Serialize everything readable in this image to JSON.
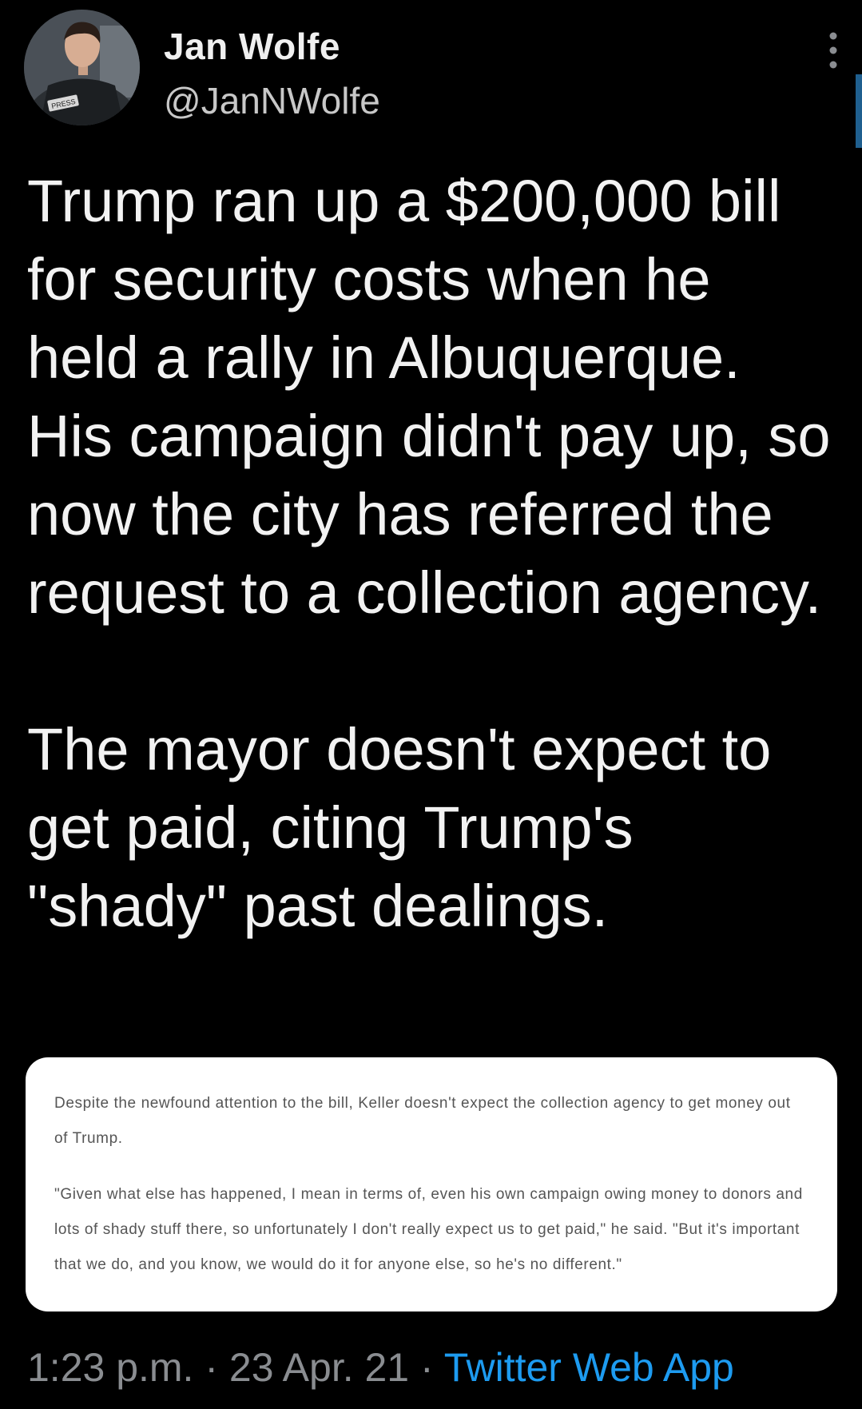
{
  "author": {
    "display_name": "Jan Wolfe",
    "handle": "@JanNWolfe",
    "avatar_badge_text": "PRESS"
  },
  "tweet": {
    "paragraphs": [
      "Trump ran up a $200,000 bill for security costs when he held a rally in Albuquerque. His campaign didn't pay up, so now the city has referred the request to a collection agency.",
      "The mayor doesn't expect to get paid, citing Trump's \"shady\" past dealings."
    ]
  },
  "attached_image": {
    "paragraph_1": "Despite the newfound attention to the bill, Keller doesn't expect the collection agency to get money out of Trump.",
    "paragraph_2": "\"Given what else has happened, I mean in terms of, even his own campaign owing money to donors and lots of shady stuff there, so unfortunately I don't really expect us to get paid,\" he said. \"But it's important that we do, and you know, we would do it for anyone else, so he's no different.\""
  },
  "footer": {
    "time": "1:23 p.m.",
    "separator": "·",
    "date": "23 Apr. 21",
    "source": "Twitter Web App"
  },
  "icons": {
    "more": "more-vertical-icon"
  },
  "colors": {
    "background": "#000000",
    "text": "#f2f2f2",
    "secondary": "#8a8d91",
    "link": "#1d9bf0",
    "card": "#ffffff"
  }
}
